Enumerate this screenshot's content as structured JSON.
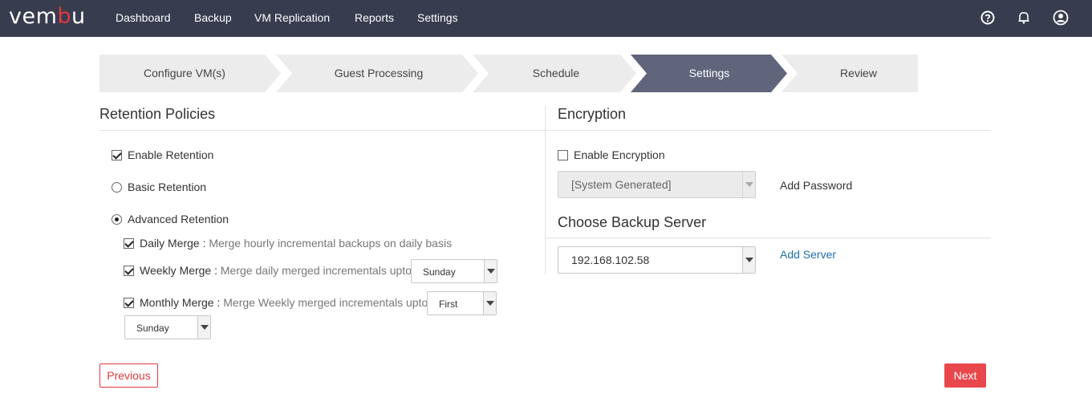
{
  "header": {
    "logo_prefix": "vem",
    "logo_red": "b",
    "logo_suffix": "u",
    "nav": [
      "Dashboard",
      "Backup",
      "VM Replication",
      "Reports",
      "Settings"
    ],
    "icons": [
      "help-icon",
      "bell-icon",
      "user-icon"
    ]
  },
  "wizard": {
    "steps": [
      "Configure VM(s)",
      "Guest Processing",
      "Schedule",
      "Settings",
      "Review"
    ],
    "active_step": "Settings"
  },
  "retention": {
    "title": "Retention Policies",
    "enable_label": "Enable Retention",
    "enable_checked": true,
    "basic_label": "Basic Retention",
    "advanced_label": "Advanced Retention",
    "selected_mode": "Advanced Retention",
    "daily": {
      "label": "Daily Merge :",
      "desc": "Merge hourly incremental backups on daily basis",
      "checked": true
    },
    "weekly": {
      "label": "Weekly Merge :",
      "desc": "Merge daily merged incrementals upto",
      "checked": true,
      "day": "Sunday"
    },
    "monthly": {
      "label": "Monthly Merge :",
      "desc": "Merge Weekly merged incrementals upto",
      "checked": true,
      "week": "First",
      "day": "Sunday"
    }
  },
  "encryption": {
    "title": "Encryption",
    "enable_label": "Enable Encryption",
    "enable_checked": false,
    "password_value": "[System Generated]",
    "add_password": "Add Password"
  },
  "backup_server": {
    "title": "Choose Backup Server",
    "value": "192.168.102.58",
    "add_server": "Add Server"
  },
  "footer": {
    "previous": "Previous",
    "next": "Next"
  },
  "colors": {
    "topbar": "#373c4e",
    "accent_red": "#e0393e",
    "active_step": "#60657b",
    "link_blue": "#1f6ea8"
  }
}
